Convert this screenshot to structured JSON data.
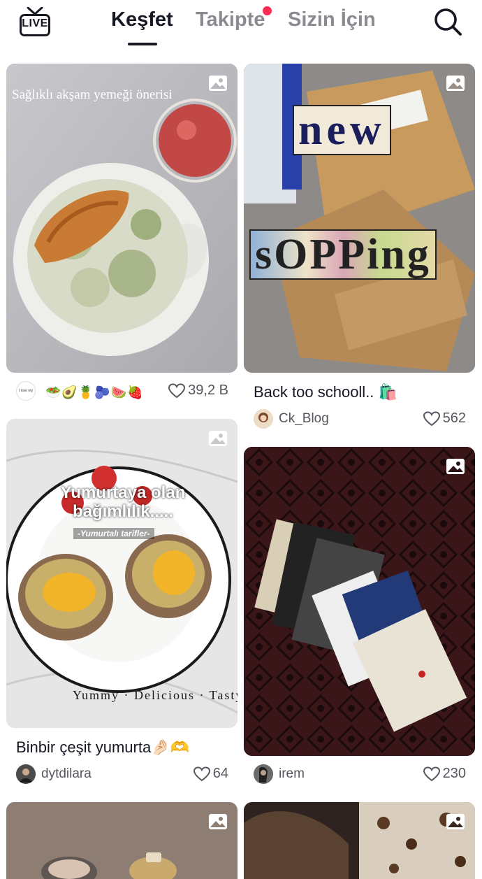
{
  "header": {
    "live_label": "LIVE",
    "tabs": [
      {
        "label": "Keşfet",
        "active": true
      },
      {
        "label": "Takipte",
        "active": false,
        "has_notification_dot": true
      },
      {
        "label": "Sizin İçin",
        "active": false
      }
    ],
    "search_icon": "search-icon"
  },
  "feed": {
    "cards": [
      {
        "overlay_text": "Sağlıklı akşam yemeği önerisi",
        "avatar_text": "I love my body",
        "emojis": "🥗🥑🍍🫐🍉🍓",
        "likes": "39,2 B",
        "media_icon": "photo-icon"
      },
      {
        "caption": "Back too schooll.. 🛍️",
        "overlay_words": [
          "new",
          "sOPPing"
        ],
        "author": "Ck_Blog",
        "likes": "562",
        "media_icon": "photo-icon"
      },
      {
        "overlay_title": "Yumurtaya olan bağımlılık.....",
        "overlay_subtitle": "-Yumurtalı tarifler-",
        "plate_text": "Yummy · Delicious · Tasty",
        "caption": "Binbir çeşit yumurta🤌🏻🫶",
        "author": "dytdilara",
        "likes": "64",
        "media_icon": "photo-icon"
      },
      {
        "author": "irem",
        "likes": "230",
        "media_icon": "photo-icon"
      },
      {
        "media_icon": "photo-icon"
      },
      {
        "media_icon": "photo-icon"
      }
    ]
  },
  "colors": {
    "text_primary": "#161823",
    "text_secondary": "#8a8b91",
    "accent_red": "#fe2c55"
  }
}
